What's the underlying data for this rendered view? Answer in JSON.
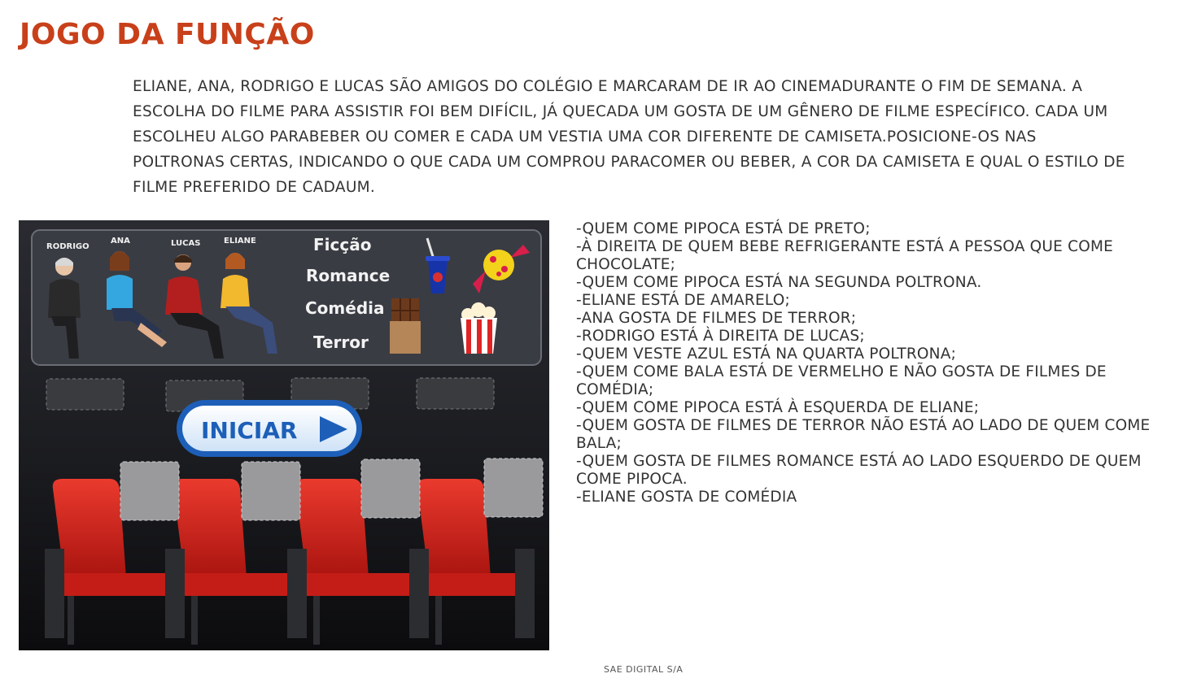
{
  "page": {
    "title": "JOGO DA FUNÇÃO",
    "intro": "ELIANE, ANA, RODRIGO E LUCAS SÃO AMIGOS DO COLÉGIO E MARCARAM DE IR AO CINEMADURANTE O FIM DE SEMANA. A ESCOLHA DO FILME PARA ASSISTIR FOI BEM DIFÍCIL, JÁ QUECADA UM GOSTA DE UM GÊNERO DE FILME ESPECÍFICO. CADA UM ESCOLHEU ALGO PARABEBER OU COMER E CADA UM VESTIA UMA COR DIFERENTE DE CAMISETA.POSICIONE-OS NAS POLTRONAS CERTAS, INDICANDO O QUE CADA UM COMPROU PARACOMER OU BEBER, A COR DA CAMISETA E QUAL O ESTILO DE FILME PREFERIDO DE CADAUM.",
    "footer": "SAE DIGITAL S/A"
  },
  "game": {
    "characters": [
      "RODRIGO",
      "ANA",
      "LUCAS",
      "ELIANE"
    ],
    "genres": [
      "Ficção",
      "Romance",
      "Comédia",
      "Terror"
    ],
    "items": [
      "soda-cup",
      "candy",
      "chocolate-bar",
      "popcorn"
    ],
    "start_label": "INICIAR",
    "seat_color": "#d42a22",
    "background_color": "#1b1c20",
    "button_color": "#1d5fb8"
  },
  "clues": [
    "-QUEM COME PIPOCA ESTÁ DE PRETO;",
    "-À DIREITA DE QUEM BEBE REFRIGERANTE ESTÁ A PESSOA QUE COME CHOCOLATE;",
    "-QUEM COME PIPOCA ESTÁ NA SEGUNDA POLTRONA.",
    "-ELIANE ESTÁ DE AMARELO;",
    "-ANA GOSTA DE FILMES DE TERROR;",
    "-RODRIGO ESTÁ À DIREITA DE LUCAS;",
    "-QUEM VESTE AZUL ESTÁ NA QUARTA POLTRONA;",
    "-QUEM COME BALA ESTÁ DE VERMELHO E NÃO GOSTA DE FILMES DE COMÉDIA;",
    "-QUEM COME PIPOCA ESTÁ À ESQUERDA DE ELIANE;",
    "-QUEM GOSTA DE FILMES DE TERROR NÃO ESTÁ AO LADO DE QUEM COME BALA;",
    "-QUEM GOSTA DE FILMES ROMANCE ESTÁ AO LADO ESQUERDO DE QUEM COME PIPOCA.",
    "-ELIANE GOSTA DE COMÉDIA"
  ]
}
